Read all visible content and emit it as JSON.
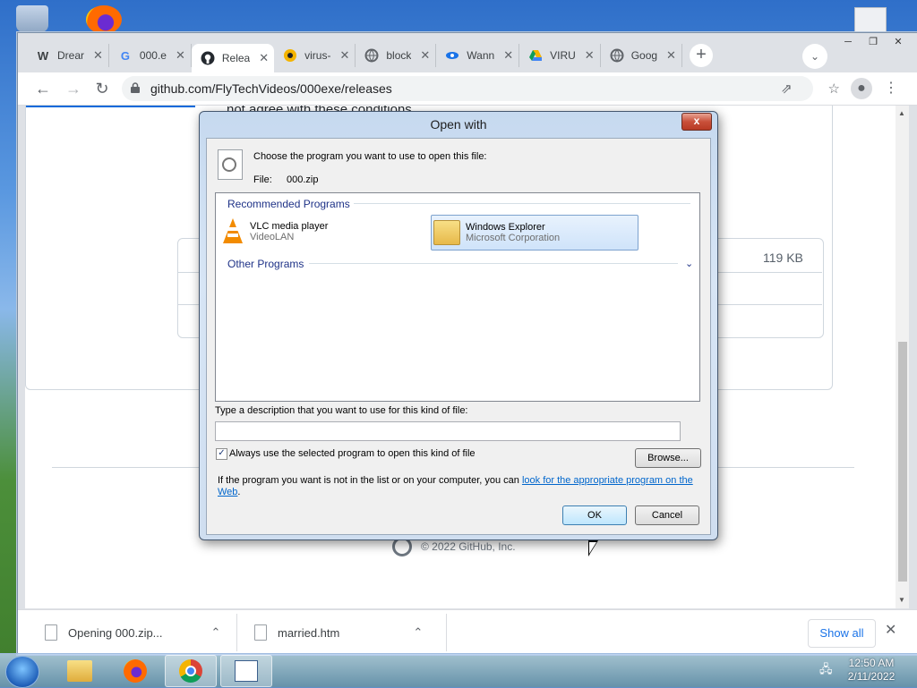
{
  "browser": {
    "tabs": [
      {
        "favicon": "W",
        "title": "Drear",
        "icon": "wikipedia-icon"
      },
      {
        "favicon": "G",
        "title": "000.e",
        "icon": "google-icon"
      },
      {
        "favicon": "github",
        "title": "Relea",
        "icon": "github-icon",
        "active": true
      },
      {
        "favicon": "virus",
        "title": "virus-",
        "icon": "virustotal-icon"
      },
      {
        "favicon": "globe",
        "title": "block",
        "icon": "globe-icon"
      },
      {
        "favicon": "wannacry",
        "title": "Wann",
        "icon": "wannacry-icon"
      },
      {
        "favicon": "drive",
        "title": "VIRU",
        "icon": "google-drive-icon"
      },
      {
        "favicon": "globe",
        "title": "Goog",
        "icon": "globe-icon"
      }
    ],
    "url": "github.com/FlyTechVideos/000exe/releases",
    "page": {
      "partial_text": "not agree with these conditions",
      "file_size": "119 KB",
      "footer": "© 2022 GitHub, Inc."
    },
    "downloads": [
      {
        "name": "Opening 000.zip..."
      },
      {
        "name": "married.htm"
      }
    ],
    "show_all_label": "Show all"
  },
  "dialog": {
    "title": "Open with",
    "close_label": "x",
    "instruction": "Choose the program you want to use to open this file:",
    "file_label": "File:",
    "file_name": "000.zip",
    "recommended_header": "Recommended Programs",
    "other_header": "Other Programs",
    "programs": [
      {
        "name": "VLC media player",
        "company": "VideoLAN"
      },
      {
        "name": "Windows Explorer",
        "company": "Microsoft Corporation",
        "selected": true
      }
    ],
    "description_label": "Type a description that you want to use for this kind of file:",
    "description_value": "",
    "always_use_label": "Always use the selected program to open this kind of file",
    "always_use_checked": true,
    "browse_label": "Browse...",
    "help_prefix": "If the program you want is not in the list or on your computer, you can ",
    "help_link": "look for the appropriate program on the Web",
    "help_suffix": ".",
    "ok_label": "OK",
    "cancel_label": "Cancel"
  },
  "taskbar": {
    "time": "12:50 AM",
    "date": "2/11/2022"
  }
}
